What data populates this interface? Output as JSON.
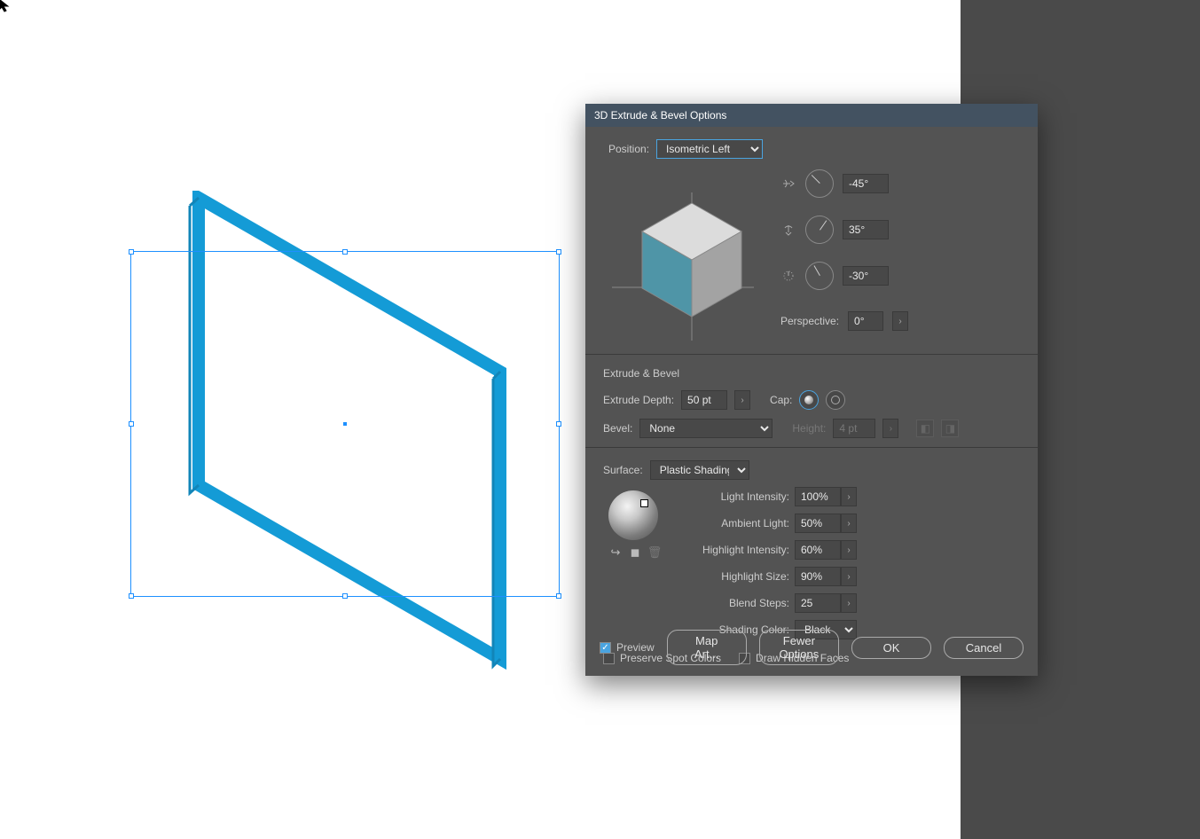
{
  "dialog": {
    "title": "3D Extrude & Bevel Options",
    "position_label": "Position:",
    "position_value": "Isometric Left",
    "rotation": {
      "x": "-45°",
      "y": "35°",
      "z": "-30°"
    },
    "perspective_label": "Perspective:",
    "perspective_value": "0°",
    "extrude_section": "Extrude & Bevel",
    "extrude_depth_label": "Extrude Depth:",
    "extrude_depth_value": "50 pt",
    "cap_label": "Cap:",
    "bevel_label": "Bevel:",
    "bevel_value": "None",
    "height_label": "Height:",
    "height_value": "4 pt",
    "surface_label": "Surface:",
    "surface_value": "Plastic Shading",
    "light_intensity_label": "Light Intensity:",
    "light_intensity_value": "100%",
    "ambient_light_label": "Ambient Light:",
    "ambient_light_value": "50%",
    "highlight_intensity_label": "Highlight Intensity:",
    "highlight_intensity_value": "60%",
    "highlight_size_label": "Highlight Size:",
    "highlight_size_value": "90%",
    "blend_steps_label": "Blend Steps:",
    "blend_steps_value": "25",
    "shading_color_label": "Shading Color:",
    "shading_color_value": "Black",
    "preserve_spot": "Preserve Spot Colors",
    "draw_hidden": "Draw Hidden Faces",
    "preview": "Preview",
    "map_art": "Map Art...",
    "fewer_options": "Fewer Options",
    "ok": "OK",
    "cancel": "Cancel"
  }
}
